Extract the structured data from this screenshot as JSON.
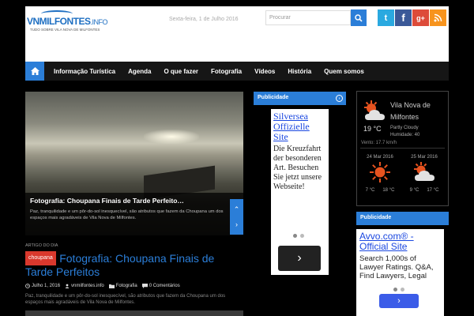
{
  "site": {
    "logo_main": "VNMILFONTES",
    "logo_suffix": ".INFO",
    "tagline": "TUDO SOBRE VILA NOVA DE MILFONTES",
    "date": "Sexta-feira, 1 de Julho 2016"
  },
  "search": {
    "placeholder": "Procurar"
  },
  "social": [
    {
      "name": "twitter-icon",
      "glyph": "t",
      "color": "#2aa9e0"
    },
    {
      "name": "facebook-icon",
      "glyph": "f",
      "color": "#3b5998"
    },
    {
      "name": "google-plus-icon",
      "glyph": "g+",
      "color": "#dd4b39"
    },
    {
      "name": "rss-icon",
      "glyph": ")",
      "color": "#f7941e"
    }
  ],
  "nav": {
    "items": [
      "Informação Turística",
      "Agenda",
      "O que fazer",
      "Fotografia",
      "Vídeos",
      "História",
      "Quem somos"
    ]
  },
  "hero": {
    "title": "Fotografia: Choupana Finais de Tarde Perfeito…",
    "desc": "Paz, tranquilidade e um pôr-do-sol inesquecível, são atributos que fazem da Choupana um dos espaços mais agradáveis de Vila Nova de Milfontes."
  },
  "post": {
    "kicker": "ARTIGO DO DIA",
    "category": "choupana",
    "title": "Fotografia: Choupana Finais de Tarde Perfeitos",
    "date": "Julho 1, 2016",
    "author": "vnmilfontes.info",
    "section": "Fotografia",
    "comments": "0 Comentários",
    "excerpt": "Paz, tranquilidade e um pôr-do-sol inesquecível, são atributos que fazem da Choupana um dos espaços mais agradáveis de Vila Nova de Milfontes."
  },
  "ad1": {
    "header": "Publicidade",
    "title": "Silversea Offizielle Site",
    "body": "Die Kreuzfahrt der besonderen Art. Besuchen Sie jetzt unsere Webseite!",
    "button_glyph": "›"
  },
  "weather": {
    "location": "Vila Nova de Milfontes",
    "temp": "19 °C",
    "condition": "Partly Cloudy",
    "humidity": "Humidade: 40",
    "wind": "Vento: 17.7 km/h",
    "forecast": [
      {
        "date": "24 Mar 2016",
        "low": "7 °C",
        "high": "18 °C"
      },
      {
        "date": "25 Mar 2016",
        "low": "9 °C",
        "high": "17 °C"
      }
    ]
  },
  "ad2": {
    "header": "Publicidade",
    "title": "Avvo.com® - Official Site",
    "body": "Search 1,000s of Lawyer Ratings. Q&A, Find Lawyers, Legal",
    "button_glyph": "›"
  },
  "colors": {
    "accent": "#2b7ed8",
    "badge": "#d9382d",
    "nav_bg": "#161616"
  }
}
